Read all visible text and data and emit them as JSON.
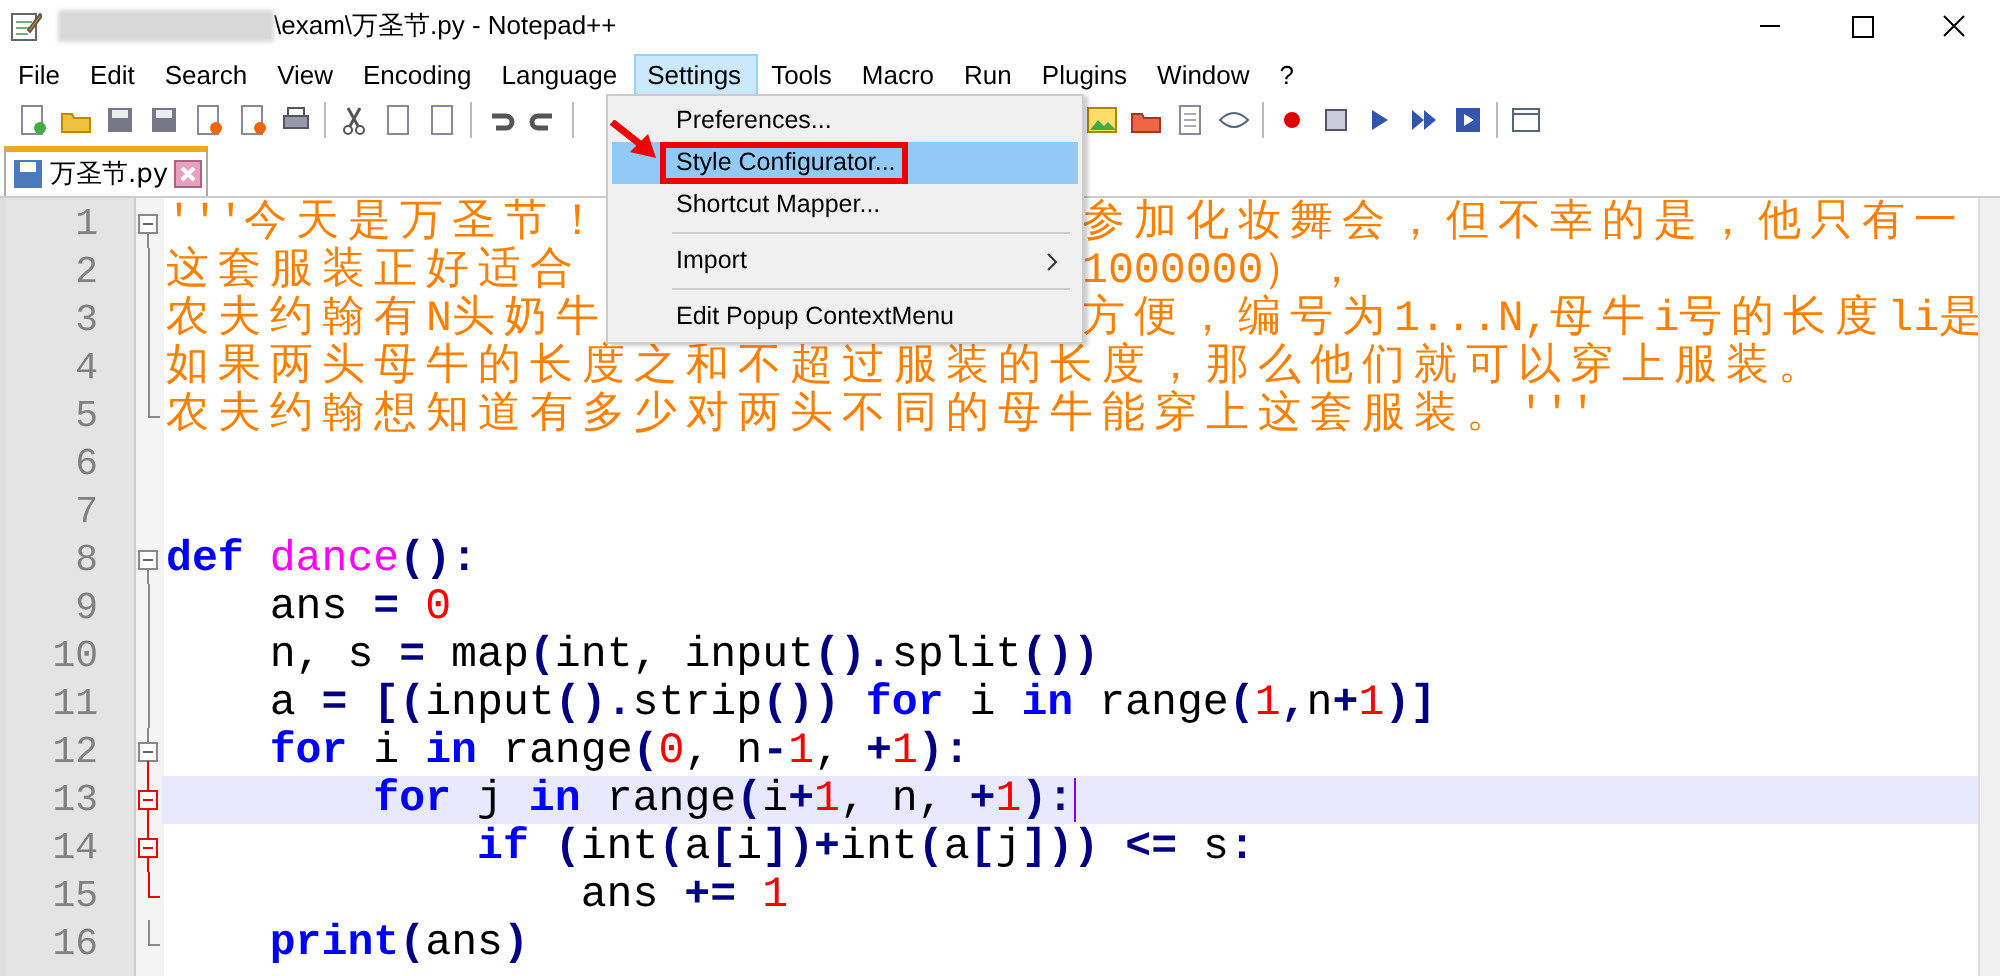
{
  "window": {
    "title": "\\exam\\万圣节.py - Notepad++"
  },
  "menu_bar": [
    {
      "label": "File",
      "selected": false
    },
    {
      "label": "Edit",
      "selected": false
    },
    {
      "label": "Search",
      "selected": false
    },
    {
      "label": "View",
      "selected": false
    },
    {
      "label": "Encoding",
      "selected": false
    },
    {
      "label": "Language",
      "selected": false
    },
    {
      "label": "Settings",
      "selected": true
    },
    {
      "label": "Tools",
      "selected": false
    },
    {
      "label": "Macro",
      "selected": false
    },
    {
      "label": "Run",
      "selected": false
    },
    {
      "label": "Plugins",
      "selected": false
    },
    {
      "label": "Window",
      "selected": false
    },
    {
      "label": "?",
      "selected": false
    }
  ],
  "dropdown": [
    {
      "kind": "item",
      "label": "Preferences...",
      "selected": false,
      "annotated": false
    },
    {
      "kind": "item",
      "label": "Style Configurator...",
      "selected": true,
      "annotated": true
    },
    {
      "kind": "item",
      "label": "Shortcut Mapper...",
      "selected": false,
      "annotated": false
    },
    {
      "kind": "separator"
    },
    {
      "kind": "submenu",
      "label": "Import",
      "selected": false,
      "annotated": false
    },
    {
      "kind": "separator"
    },
    {
      "kind": "item",
      "label": "Edit Popup ContextMenu",
      "selected": false,
      "annotated": false
    }
  ],
  "tabs": [
    {
      "label": "万圣节.py",
      "selected": true
    }
  ],
  "lines": [
    {
      "number": "1",
      "kind": "fold-open",
      "highlight": false,
      "current": false,
      "tokens": [
        {
          "kind": "str",
          "text": "'''今天是万圣节！"
        }
      ],
      "after_menu": [
        {
          "kind": "str",
          "text": "参加化妆舞会，但不幸的是，他只有一"
        }
      ]
    },
    {
      "number": "2",
      "kind": "fold-line",
      "highlight": false,
      "current": false,
      "tokens": [
        {
          "kind": "str",
          "text": "这套服装正好适合"
        }
      ],
      "after_menu": [
        {
          "kind": "str",
          "text": "1000000），"
        }
      ]
    },
    {
      "number": "3",
      "kind": "fold-line",
      "highlight": false,
      "current": false,
      "tokens": [
        {
          "kind": "str",
          "text": "农夫约翰有N头奶牛"
        }
      ],
      "after_menu": [
        {
          "kind": "str",
          "text": "方便，编号为1...N,母牛i号的长度li是"
        }
      ]
    },
    {
      "number": "4",
      "kind": "fold-line",
      "highlight": false,
      "current": false,
      "tokens": [
        {
          "kind": "str",
          "text": "如果两头母牛的长度之和不超过服装的长度，那么他们就可以穿上服装。"
        }
      ]
    },
    {
      "number": "5",
      "kind": "fold-end",
      "highlight": false,
      "current": false,
      "tokens": [
        {
          "kind": "str",
          "text": "农夫约翰想知道有多少对两头不同的母牛能穿上这套服装。'''"
        }
      ]
    },
    {
      "number": "6",
      "kind": "plain",
      "current": false
    },
    {
      "number": "7",
      "kind": "plain",
      "current": false
    },
    {
      "number": "8",
      "kind": "fold-open",
      "highlight": false,
      "current": false,
      "tokens": [
        {
          "kind": "kw",
          "text": "def"
        },
        {
          "kind": "fn",
          "text": " dance"
        },
        {
          "kind": "op",
          "text": "():"
        }
      ]
    },
    {
      "number": "9",
      "kind": "fold-line",
      "highlight": false,
      "current": false,
      "tokens": [
        {
          "kind": "plain",
          "text": "    ans"
        },
        {
          "kind": "op",
          "text": " ="
        },
        {
          "kind": "num",
          "text": " 0"
        }
      ]
    },
    {
      "number": "10",
      "kind": "fold-line",
      "highlight": false,
      "current": false,
      "tokens": [
        {
          "kind": "plain",
          "text": "    n, s"
        },
        {
          "kind": "op",
          "text": " ="
        },
        {
          "kind": "plain",
          "text": " map"
        },
        {
          "kind": "op",
          "text": "("
        },
        {
          "kind": "plain",
          "text": "int, input"
        },
        {
          "kind": "op",
          "text": "()."
        },
        {
          "kind": "plain",
          "text": "split"
        },
        {
          "kind": "op",
          "text": "())"
        }
      ]
    },
    {
      "number": "11",
      "kind": "fold-line",
      "highlight": false,
      "current": false,
      "tokens": [
        {
          "kind": "plain",
          "text": "    a"
        },
        {
          "kind": "op",
          "text": " = [("
        },
        {
          "kind": "plain",
          "text": "input"
        },
        {
          "kind": "op",
          "text": "()."
        },
        {
          "kind": "plain",
          "text": "strip"
        },
        {
          "kind": "op",
          "text": "())"
        },
        {
          "kind": "kw",
          "text": " for"
        },
        {
          "kind": "plain",
          "text": " i"
        },
        {
          "kind": "kw",
          "text": " in"
        },
        {
          "kind": "plain",
          "text": " range"
        },
        {
          "kind": "op",
          "text": "("
        },
        {
          "kind": "num",
          "text": "1"
        },
        {
          "kind": "op",
          "text": ","
        },
        {
          "kind": "plain",
          "text": "n"
        },
        {
          "kind": "op",
          "text": "+"
        },
        {
          "kind": "num",
          "text": "1"
        },
        {
          "kind": "op",
          "text": ")]"
        }
      ]
    },
    {
      "number": "12",
      "kind": "fold-open",
      "highlight": false,
      "current": false,
      "tokens": [
        {
          "kind": "kw",
          "text": "    for"
        },
        {
          "kind": "plain",
          "text": " i"
        },
        {
          "kind": "kw",
          "text": " in"
        },
        {
          "kind": "plain",
          "text": " range"
        },
        {
          "kind": "op",
          "text": "("
        },
        {
          "kind": "num",
          "text": "0"
        },
        {
          "kind": "plain",
          "text": ", n"
        },
        {
          "kind": "op",
          "text": "-"
        },
        {
          "kind": "num",
          "text": "1"
        },
        {
          "kind": "plain",
          "text": ","
        },
        {
          "kind": "op",
          "text": " +"
        },
        {
          "kind": "num",
          "text": "1"
        },
        {
          "kind": "op",
          "text": "):"
        }
      ]
    },
    {
      "number": "13",
      "kind": "fold-open",
      "highlight": true,
      "current": true,
      "tokens": [
        {
          "kind": "kw",
          "text": "        for"
        },
        {
          "kind": "plain",
          "text": " j"
        },
        {
          "kind": "kw",
          "text": " in"
        },
        {
          "kind": "plain",
          "text": " range"
        },
        {
          "kind": "op",
          "text": "("
        },
        {
          "kind": "plain",
          "text": "i"
        },
        {
          "kind": "op",
          "text": "+"
        },
        {
          "kind": "num",
          "text": "1"
        },
        {
          "kind": "plain",
          "text": ", n,"
        },
        {
          "kind": "op",
          "text": " +"
        },
        {
          "kind": "num",
          "text": "1"
        },
        {
          "kind": "op",
          "text": "):"
        }
      ]
    },
    {
      "number": "14",
      "kind": "fold-open",
      "highlight": true,
      "current": false,
      "tokens": [
        {
          "kind": "kw",
          "text": "            if"
        },
        {
          "kind": "op",
          "text": " ("
        },
        {
          "kind": "plain",
          "text": "int"
        },
        {
          "kind": "op",
          "text": "("
        },
        {
          "kind": "plain",
          "text": "a"
        },
        {
          "kind": "op",
          "text": "["
        },
        {
          "kind": "plain",
          "text": "i"
        },
        {
          "kind": "op",
          "text": "])+"
        },
        {
          "kind": "plain",
          "text": "int"
        },
        {
          "kind": "op",
          "text": "("
        },
        {
          "kind": "plain",
          "text": "a"
        },
        {
          "kind": "op",
          "text": "["
        },
        {
          "kind": "plain",
          "text": "j"
        },
        {
          "kind": "op",
          "text": "]))"
        },
        {
          "kind": "op",
          "text": " <="
        },
        {
          "kind": "plain",
          "text": " s"
        },
        {
          "kind": "op",
          "text": ":"
        }
      ]
    },
    {
      "number": "15",
      "kind": "fold-end",
      "highlight": true,
      "current": false,
      "tokens": [
        {
          "kind": "plain",
          "text": "                ans"
        },
        {
          "kind": "op",
          "text": " +="
        },
        {
          "kind": "num",
          "text": " 1"
        }
      ]
    },
    {
      "number": "16",
      "kind": "fold-end",
      "highlight": false,
      "current": false,
      "tokens": [
        {
          "kind": "kw",
          "text": "    print"
        },
        {
          "kind": "op",
          "text": "("
        },
        {
          "kind": "plain",
          "text": "ans"
        },
        {
          "kind": "op",
          "text": ")"
        }
      ]
    }
  ]
}
